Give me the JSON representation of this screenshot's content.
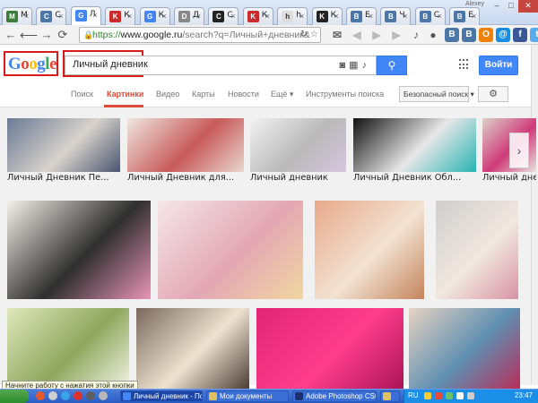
{
  "browser": {
    "profile_label": "Alexey",
    "tabs": [
      {
        "letter": "M",
        "color": "#3a7d3a",
        "label": "М",
        "active": false
      },
      {
        "letter": "C",
        "color": "#4a76a8",
        "label": "С",
        "active": false
      },
      {
        "letter": "G",
        "color": "#4285f4",
        "label": "Л",
        "active": true
      },
      {
        "letter": "K",
        "color": "#cc2b2b",
        "label": "К",
        "active": false
      },
      {
        "letter": "G",
        "color": "#4285f4",
        "label": "К",
        "active": false
      },
      {
        "letter": "D",
        "color": "#888888",
        "label": "Д",
        "active": false
      },
      {
        "letter": "C",
        "color": "#222222",
        "label": "С",
        "active": false
      },
      {
        "letter": "K",
        "color": "#cc2b2b",
        "label": "К",
        "active": false
      },
      {
        "letter": "h",
        "color": "#dddddd",
        "label": "h",
        "active": false
      },
      {
        "letter": "K",
        "color": "#222222",
        "label": "К",
        "active": false
      },
      {
        "letter": "B",
        "color": "#4a76a8",
        "label": "Е",
        "active": false
      },
      {
        "letter": "B",
        "color": "#4a76a8",
        "label": "Ч",
        "active": false
      },
      {
        "letter": "B",
        "color": "#4a76a8",
        "label": "С",
        "active": false
      },
      {
        "letter": "B",
        "color": "#4a76a8",
        "label": "Е",
        "active": false
      }
    ],
    "url": {
      "scheme": "https://",
      "host": "www.google.ru",
      "path": "/search?q=Личный+дневник&"
    },
    "extensions": [
      {
        "name": "mail-icon",
        "glyph": "✉",
        "color": "#666666"
      },
      {
        "name": "play-back-icon",
        "glyph": "◀",
        "color": "#bbbbbb"
      },
      {
        "name": "play-icon",
        "glyph": "▶",
        "color": "#bbbbbb"
      },
      {
        "name": "play-forward-icon",
        "glyph": "▶",
        "color": "#bbbbbb"
      },
      {
        "name": "music-icon",
        "glyph": "♪",
        "color": "#555555"
      },
      {
        "name": "chat-icon",
        "glyph": "●",
        "color": "#555555"
      },
      {
        "name": "vk-icon",
        "glyph": "В",
        "color": "#4a76a8"
      },
      {
        "name": "vk-icon-2",
        "glyph": "В",
        "color": "#4a76a8"
      },
      {
        "name": "odnoklassniki-icon",
        "glyph": "О",
        "color": "#ee8208"
      },
      {
        "name": "mail-ru-icon",
        "glyph": "@",
        "color": "#168de2"
      },
      {
        "name": "facebook-icon",
        "glyph": "f",
        "color": "#3b5998"
      },
      {
        "name": "twitter-icon",
        "glyph": "t",
        "color": "#55acee"
      }
    ]
  },
  "google": {
    "logo_letters": [
      {
        "ch": "G",
        "color": "#4285f4"
      },
      {
        "ch": "o",
        "color": "#ea4335"
      },
      {
        "ch": "o",
        "color": "#fbbc05"
      },
      {
        "ch": "g",
        "color": "#4285f4"
      },
      {
        "ch": "l",
        "color": "#34a853"
      },
      {
        "ch": "e",
        "color": "#ea4335"
      }
    ],
    "query": "Личный дневник",
    "signin_label": "Войти",
    "nav": [
      {
        "label": "Поиск",
        "active": false
      },
      {
        "label": "Картинки",
        "active": true
      },
      {
        "label": "Видео",
        "active": false
      },
      {
        "label": "Карты",
        "active": false
      },
      {
        "label": "Новости",
        "active": false
      },
      {
        "label": "Ещё ▾",
        "active": false
      },
      {
        "label": "Инструменты поиска",
        "active": false
      }
    ],
    "safe_search_label": "Безопасный поиск ▾"
  },
  "results": {
    "carousel": [
      {
        "caption": "Личный Дневник Пе...",
        "colors": [
          "#6b7a94",
          "#d8d2cc",
          "#4a5670"
        ]
      },
      {
        "caption": "Личный Дневник для...",
        "colors": [
          "#efe6df",
          "#c85a5a",
          "#e9d7cf"
        ]
      },
      {
        "caption": "Личный дневник",
        "colors": [
          "#f2f2f2",
          "#b9b9b9",
          "#d5c6e0"
        ]
      },
      {
        "caption": "Личный Дневник Обл...",
        "colors": [
          "#111111",
          "#e7e7e7",
          "#27b3b3"
        ]
      },
      {
        "caption": "Личный дневник",
        "colors": [
          "#dcd0c8",
          "#d03b7a",
          "#e8e2dd"
        ]
      },
      {
        "caption": "",
        "colors": [
          "#e9e2d6",
          "#58604c",
          "#efe8df"
        ]
      }
    ],
    "grid": [
      {
        "colors": [
          "#f4f1e9",
          "#2e2e2e",
          "#e895b4"
        ]
      },
      {
        "colors": [
          "#f5e6e8",
          "#e3a7b5",
          "#f0d6a0"
        ]
      },
      {
        "colors": [
          "#e8a98a",
          "#f2e2d2",
          "#c4855c"
        ]
      },
      {
        "colors": [
          "#cfcfcf",
          "#f1e7de",
          "#d893a6"
        ]
      },
      {
        "colors": [
          "#e0e7bc",
          "#8ea75d",
          "#f2f3e3"
        ]
      },
      {
        "colors": [
          "#7a6a5e",
          "#ede2d0",
          "#4b3d35"
        ]
      },
      {
        "colors": [
          "#e02676",
          "#ff3d8b",
          "#aa1456"
        ]
      },
      {
        "colors": [
          "#e6d3c3",
          "#5e8fb1",
          "#b82e5a"
        ]
      }
    ]
  },
  "status_tooltip": "Начните работу с нажатия этой кнопки",
  "taskbar": {
    "tasks": [
      {
        "label": "Личный дневник - По...",
        "color": "#4285f4",
        "active": true
      },
      {
        "label": "Мои документы",
        "color": "#e0c060",
        "active": false
      },
      {
        "label": "Adobe Photoshop CS6...",
        "color": "#1f2f6e",
        "active": false
      },
      {
        "label": "",
        "color": "#e0c060",
        "active": false
      }
    ],
    "language": "RU",
    "clock": "23:47"
  }
}
